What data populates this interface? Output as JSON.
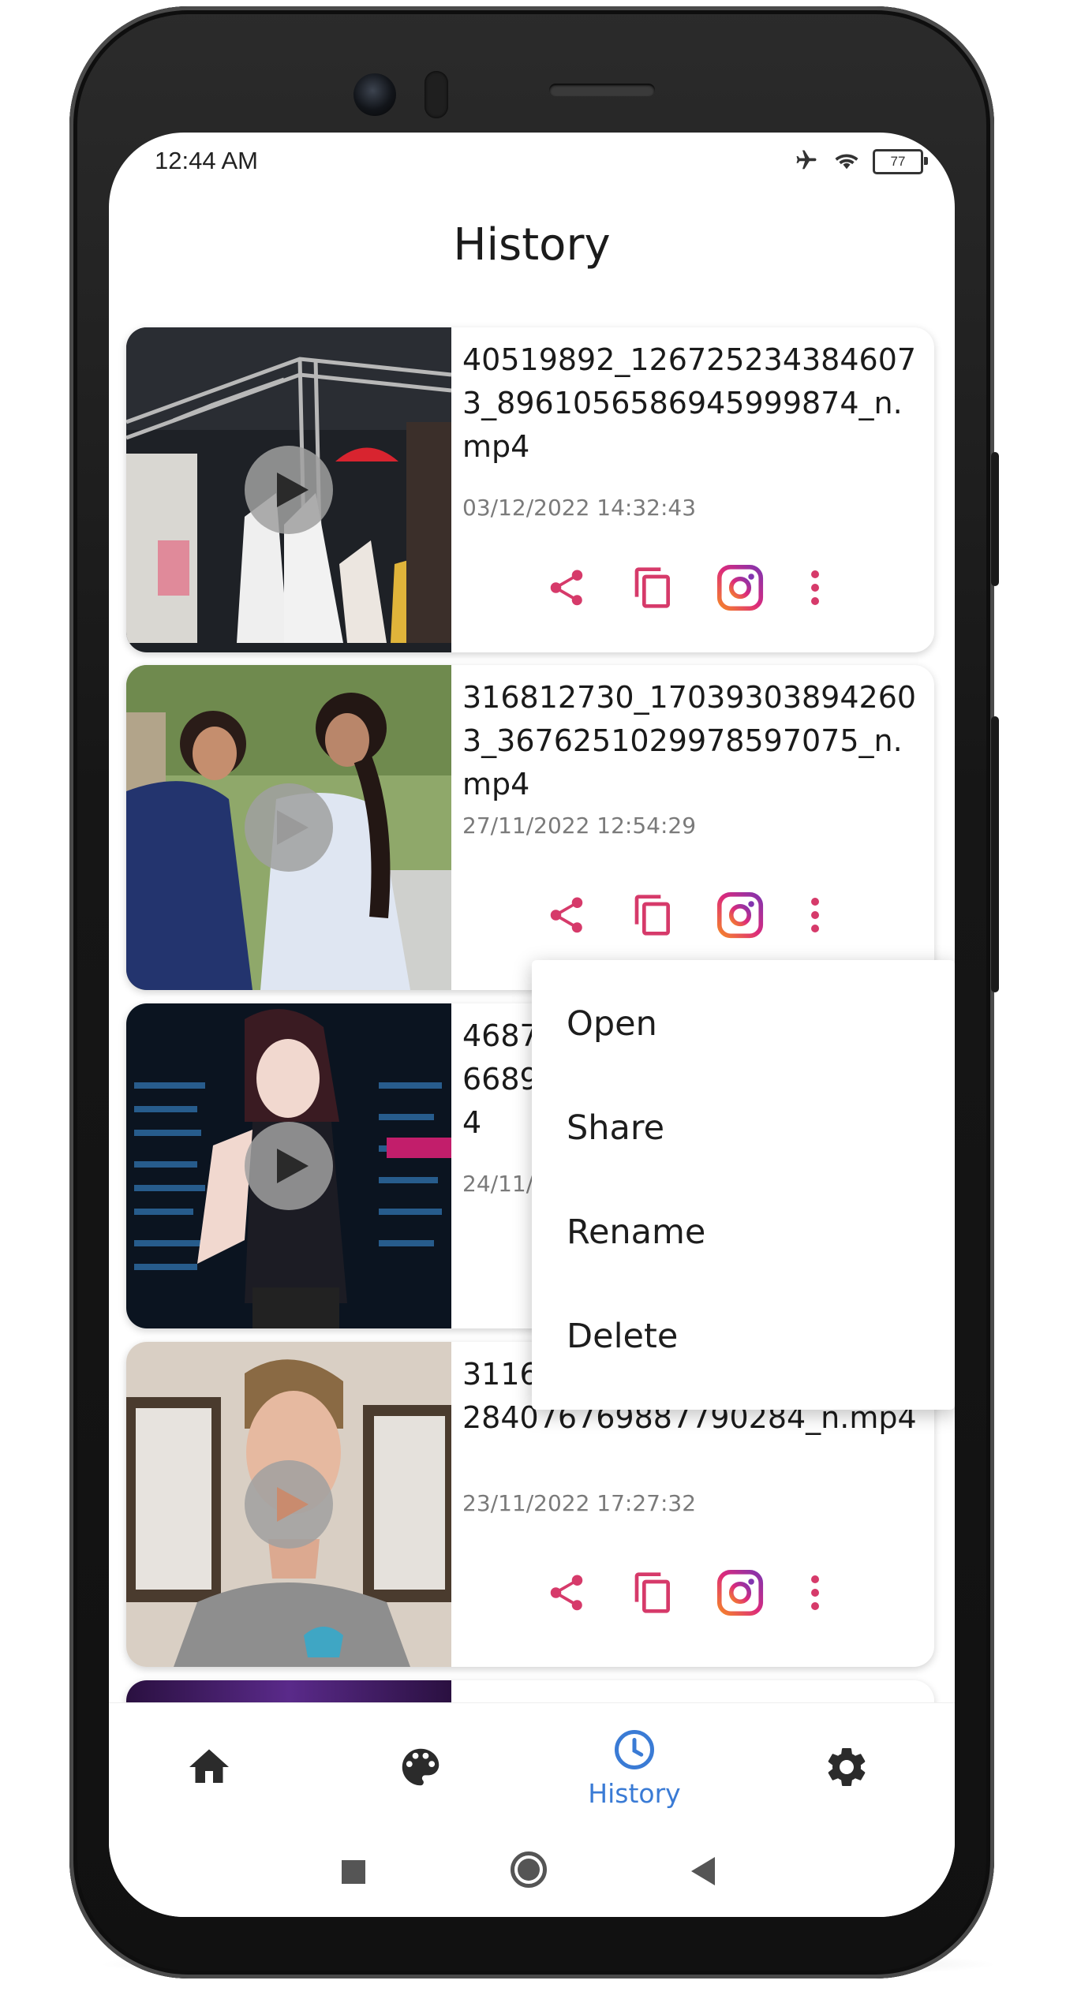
{
  "status_bar": {
    "time": "12:44 AM",
    "battery": "77"
  },
  "header": {
    "title": "History"
  },
  "history": [
    {
      "filename": "40519892_1267252343846073_8961056586945999874_n.mp4",
      "date": "03/12/2022 14:32:43"
    },
    {
      "filename": "316812730_170393038942603_3676251029978597075_n.mp4",
      "date": "27/11/2022 12:54:29"
    },
    {
      "filename": "4687",
      "filename_line2": "6689",
      "filename_line3": "4",
      "date": "24/11/2"
    },
    {
      "filename": "3116",
      "filename_line2": "284076769887790284_n.mp4",
      "date": "23/11/2022 17:27:32"
    }
  ],
  "context_menu": {
    "items": [
      "Open",
      "Share",
      "Rename",
      "Delete"
    ]
  },
  "bottom_nav": {
    "history_label": "History"
  },
  "colors": {
    "accent": "#d63a6a",
    "nav_active": "#3a7bd5",
    "instagram_start": "#f58529",
    "instagram_end": "#8134af"
  },
  "icons": [
    "share-icon",
    "copy-icon",
    "instagram-icon",
    "more-vert-icon",
    "home-icon",
    "palette-icon",
    "history-clock-icon",
    "settings-gear-icon"
  ]
}
